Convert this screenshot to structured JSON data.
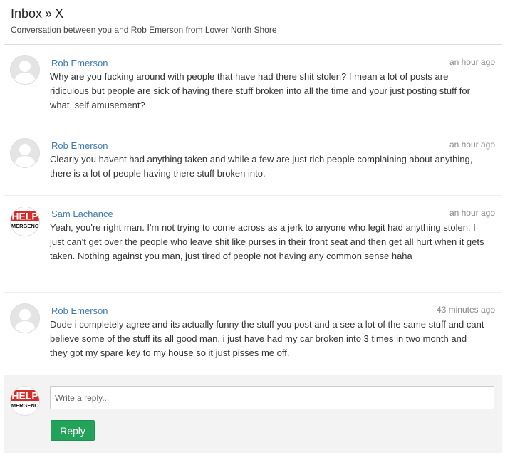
{
  "header": {
    "breadcrumb_root": "Inbox",
    "breadcrumb_sep": "»",
    "breadcrumb_current": "X",
    "subtitle": "Conversation between you and Rob Emerson from Lower North Shore"
  },
  "messages": [
    {
      "sender": "Rob Emerson",
      "time": "an hour ago",
      "avatar": "default-user-avatar",
      "text": "Why are you fucking around with people that have had there shit stolen? I mean a lot of posts are ridiculous but people are sick of having there stuff broken into all the time and your just posting stuff for what, self amusement?"
    },
    {
      "sender": "Rob Emerson",
      "time": "an hour ago",
      "avatar": "default-user-avatar",
      "text": "Clearly you havent had anything taken and while a few are just rich people complaining about anything, there is a lot of people having there stuff broken into."
    },
    {
      "sender": "Sam Lachance",
      "time": "an hour ago",
      "avatar": "help-emergency-avatar",
      "text": "Yeah, you're right man. I'm not trying to come across as a jerk to anyone who legit had anything stolen. I just can't get over the people who leave shit like purses in their front seat and then get all hurt when it gets taken. Nothing against you man, just tired of people not having any common sense haha"
    },
    {
      "sender": "Rob Emerson",
      "time": "43 minutes ago",
      "avatar": "default-user-avatar",
      "text": "Dude i completely agree and its actually funny the stuff you post and a see a lot of the same stuff and cant believe some of the stuff its all good man, i just have had my car broken into 3 times in two month and they got my spare key to my house so it just pisses me off."
    }
  ],
  "reply": {
    "placeholder": "Write a reply...",
    "value": "",
    "button_label": "Reply",
    "avatar": "help-emergency-avatar"
  },
  "colors": {
    "link": "#3e7bb0",
    "reply_button": "#23a35a",
    "reply_background": "#f3f3f3",
    "help_logo_red": "#d52b2b"
  },
  "logo_text": {
    "top": "HELP",
    "bottom": "EMERGENCY"
  }
}
